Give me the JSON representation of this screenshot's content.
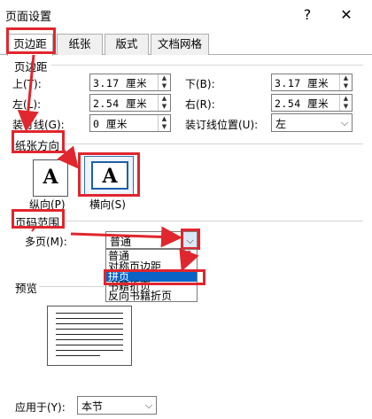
{
  "window": {
    "title": "页面设置",
    "help_label": "?",
    "close_label": "✕"
  },
  "tabs": [
    {
      "label": "页边距"
    },
    {
      "label": "纸张"
    },
    {
      "label": "版式"
    },
    {
      "label": "文档网格"
    }
  ],
  "margins": {
    "section_title": "页边距",
    "top_label": "上(T):",
    "top_value": "3.17 厘米",
    "bottom_label": "下(B):",
    "bottom_value": "3.17 厘米",
    "left_label": "左(L):",
    "left_value": "2.54 厘米",
    "right_label": "右(R):",
    "right_value": "2.54 厘米",
    "gutter_label": "装订线(G):",
    "gutter_value": "0 厘米",
    "gutter_pos_label": "装订线位置(U):",
    "gutter_pos_value": "左"
  },
  "orientation": {
    "section_title": "纸张方向",
    "portrait_label": "纵向(P)",
    "landscape_label": "横向(S)",
    "icon_glyph": "A"
  },
  "pages": {
    "section_title": "页码范围",
    "multiple_label": "多页(M):",
    "multiple_value": "普通",
    "options": [
      "普通",
      "对称页边距",
      "拼页",
      "书籍折页",
      "反向书籍折页"
    ],
    "highlighted_index": 2
  },
  "preview": {
    "section_title": "预览"
  },
  "apply": {
    "label": "应用于(Y):",
    "value": "本节"
  },
  "colors": {
    "highlight": "#0a64c8",
    "annotation_red": "#e0262e"
  }
}
